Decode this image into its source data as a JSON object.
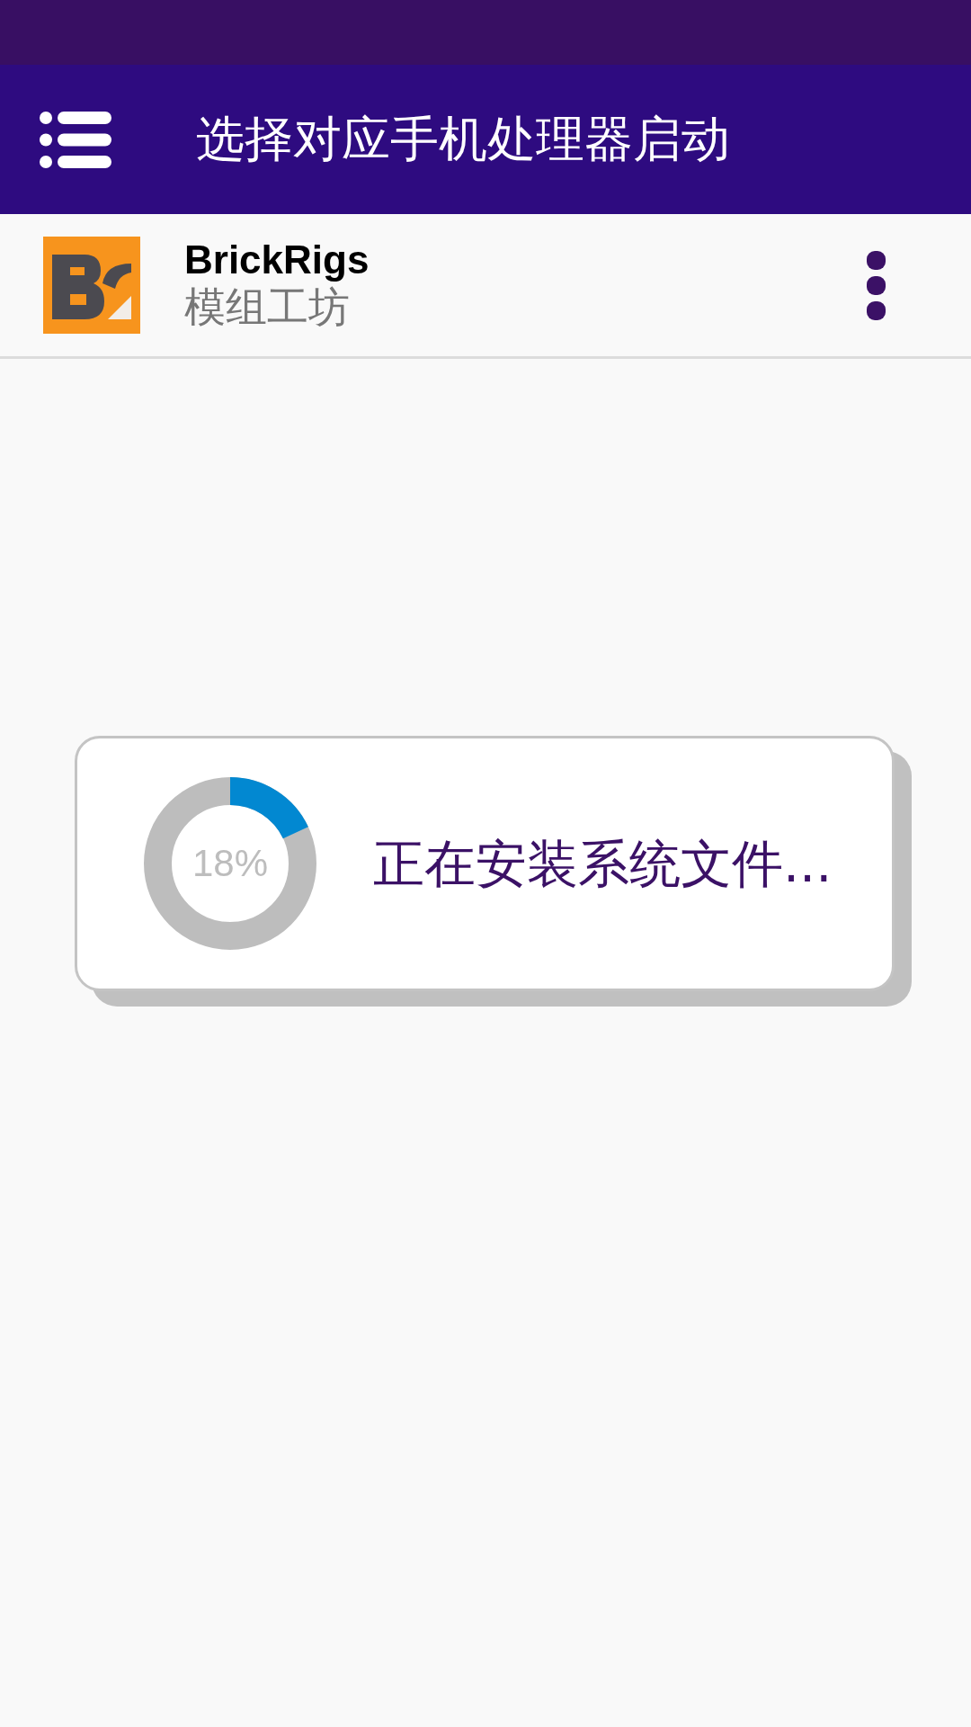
{
  "app_bar": {
    "title": "选择对应手机处理器启动"
  },
  "app_row": {
    "name": "BrickRigs",
    "subtitle": "模组工坊"
  },
  "progress_dialog": {
    "progress": {
      "level": 0.18,
      "reading": "18%"
    },
    "message": "正在安装系统文件..."
  }
}
